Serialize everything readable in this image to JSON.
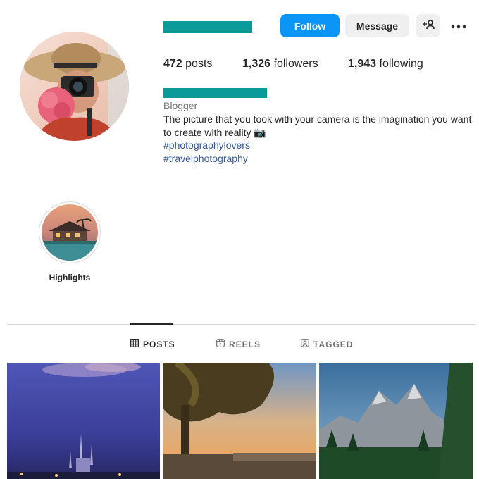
{
  "profile": {
    "follow_label": "Follow",
    "message_label": "Message",
    "stats": {
      "posts_count": "472",
      "posts_label": "posts",
      "followers_count": "1,326",
      "followers_label": "followers",
      "following_count": "1,943",
      "following_label": "following"
    },
    "category": "Blogger",
    "bio": "The picture that you took with your camera is the imagination you want to create with reality 📷",
    "hashtags": [
      "#photographylovers",
      "#travelphotography"
    ]
  },
  "highlights": [
    {
      "label": "Highlights"
    }
  ],
  "tabs": [
    {
      "label": "POSTS",
      "icon": "grid-icon",
      "active": true
    },
    {
      "label": "REELS",
      "icon": "reels-icon",
      "active": false
    },
    {
      "label": "TAGGED",
      "icon": "tagged-icon",
      "active": false
    }
  ],
  "posts": [
    {
      "subject": "castle-at-dusk-thumbnail"
    },
    {
      "subject": "tree-at-sunset-thumbnail"
    },
    {
      "subject": "mountain-forest-thumbnail"
    }
  ],
  "colors": {
    "accent": "#0b95f6",
    "redaction": "#0a9a9a",
    "hashtag": "#385898"
  }
}
